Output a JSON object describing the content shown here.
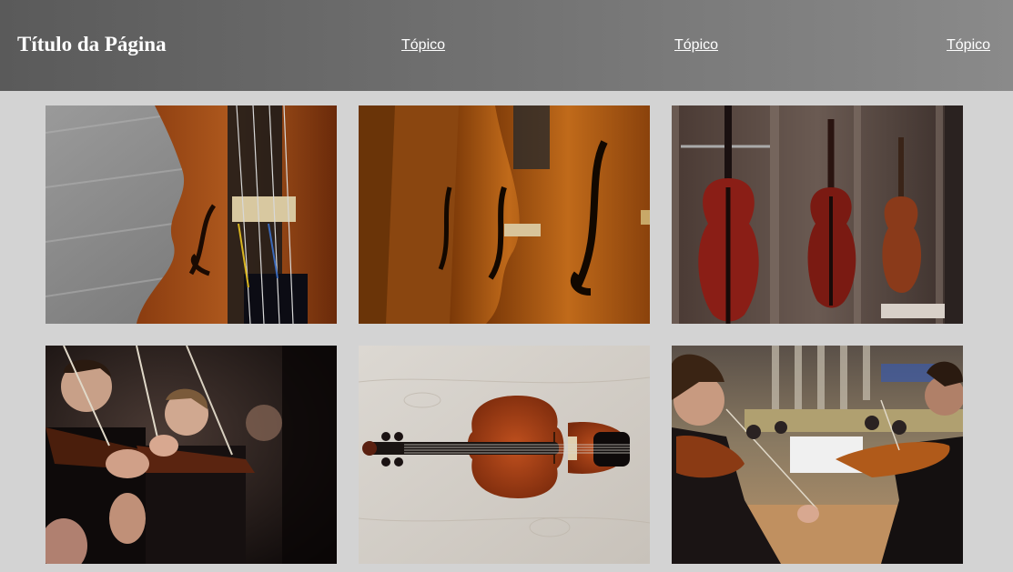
{
  "header": {
    "title": "Título da Página",
    "nav": [
      "Tópico",
      "Tópico",
      "Tópico"
    ]
  },
  "gallery": {
    "photos": [
      {
        "icon": "violin-closeup-image"
      },
      {
        "icon": "cellos-row-image"
      },
      {
        "icon": "violins-display-case-image"
      },
      {
        "icon": "orchestra-violinists-image"
      },
      {
        "icon": "violin-on-wood-image"
      },
      {
        "icon": "concert-hall-orchestra-image"
      }
    ]
  },
  "colors": {
    "header_start": "#5a5a5a",
    "header_end": "#8a8a8a",
    "background": "#d3d3d3",
    "text": "#ffffff"
  }
}
